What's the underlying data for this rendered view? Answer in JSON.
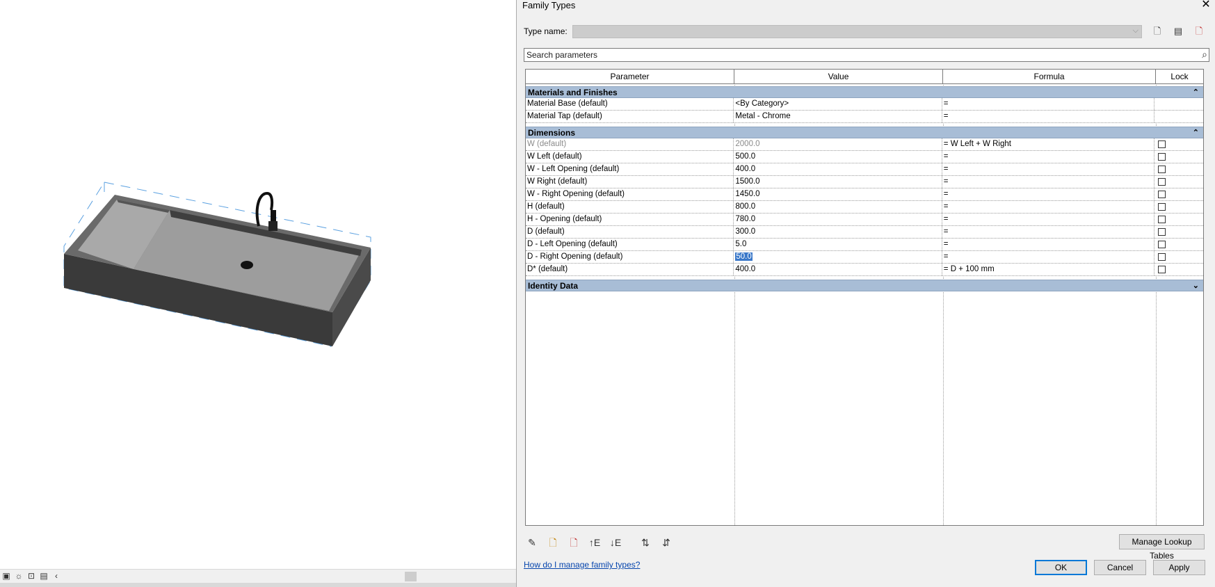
{
  "dialog": {
    "title": "Family Types",
    "type_name_label": "Type name:",
    "type_name_value": "",
    "search_placeholder": "Search parameters",
    "help_link": "How do I manage family types?",
    "buttons": {
      "manage_lookup": "Manage Lookup Tables",
      "ok": "OK",
      "cancel": "Cancel",
      "apply": "Apply"
    }
  },
  "grid": {
    "headers": {
      "parameter": "Parameter",
      "value": "Value",
      "formula": "Formula",
      "lock": "Lock"
    },
    "groups": [
      {
        "name": "Materials and Finishes",
        "rows": [
          {
            "parameter": "Material Base (default)",
            "value": "<By Category>",
            "formula": "="
          },
          {
            "parameter": "Material Tap (default)",
            "value": "Metal - Chrome",
            "formula": "="
          }
        ]
      },
      {
        "name": "Dimensions",
        "rows": [
          {
            "parameter": "W (default)",
            "value": "2000.0",
            "formula": "= W Left + W Right"
          },
          {
            "parameter": "W Left (default)",
            "value": "500.0",
            "formula": "="
          },
          {
            "parameter": "W - Left Opening (default)",
            "value": "400.0",
            "formula": "="
          },
          {
            "parameter": "W Right (default)",
            "value": "1500.0",
            "formula": "="
          },
          {
            "parameter": "W - Right Opening (default)",
            "value": "1450.0",
            "formula": "="
          },
          {
            "parameter": "H (default)",
            "value": "800.0",
            "formula": "="
          },
          {
            "parameter": "H - Opening (default)",
            "value": "780.0",
            "formula": "="
          },
          {
            "parameter": "D (default)",
            "value": "300.0",
            "formula": "="
          },
          {
            "parameter": "D - Left Opening (default)",
            "value": "5.0",
            "formula": "="
          },
          {
            "parameter": "D - Right Opening (default)",
            "value": "50.0",
            "formula": "="
          },
          {
            "parameter": "D* (default)",
            "value": "400.0",
            "formula": "= D + 100 mm"
          }
        ]
      },
      {
        "name": "Identity Data",
        "rows": []
      }
    ]
  },
  "icons": {
    "close": "close-icon",
    "search": "search-icon"
  }
}
